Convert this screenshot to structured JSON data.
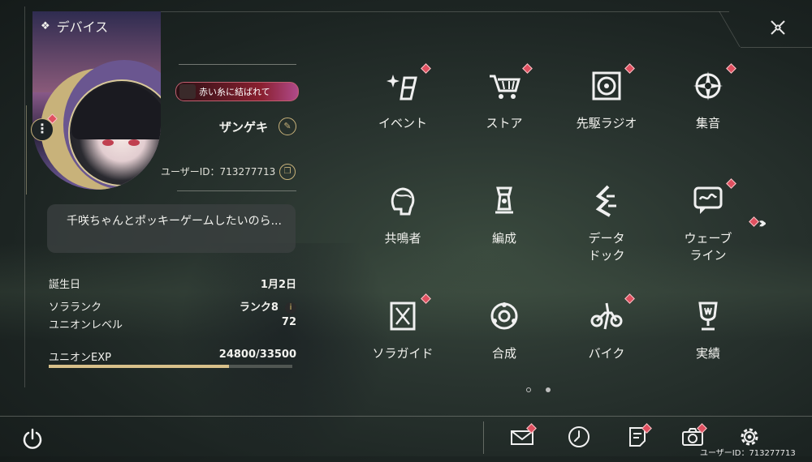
{
  "header": {
    "title": "デバイス",
    "title_icon": "diamond-cluster-icon"
  },
  "profile": {
    "badge": "赤い糸に結ばれて",
    "username": "ザンゲキ",
    "user_id_label": "ユーザーID：713277713",
    "signature": "千咲ちゃんとポッキーゲームしたいのら..."
  },
  "stats": {
    "birthday": {
      "label": "誕生日",
      "value": "1月2日"
    },
    "rank": {
      "label": "ソラランク",
      "value": "ランク8"
    },
    "level": {
      "label": "ユニオンレベル",
      "value": "72"
    },
    "exp": {
      "label": "ユニオンEXP",
      "value": "24800/33500",
      "fill": 0.74
    }
  },
  "menu": [
    {
      "label": "イベント",
      "icon": "event-sparkle-icon",
      "badge": true
    },
    {
      "label": "ストア",
      "icon": "cart-icon",
      "badge": true
    },
    {
      "label": "先駆ラジオ",
      "icon": "radio-vinyl-icon",
      "badge": true
    },
    {
      "label": "集音",
      "icon": "compass-star-icon",
      "badge": true
    },
    {
      "label": "共鳴者",
      "icon": "character-head-icon",
      "badge": false
    },
    {
      "label": "編成",
      "icon": "chess-pieces-icon",
      "badge": false
    },
    {
      "label": "データ\nドック",
      "icon": "data-dock-icon",
      "badge": false
    },
    {
      "label": "ウェーブ\nライン",
      "icon": "wave-chat-icon",
      "badge": true
    },
    {
      "label": "ソラガイド",
      "icon": "guide-book-icon",
      "badge": true
    },
    {
      "label": "合成",
      "icon": "synthesis-ring-icon",
      "badge": false
    },
    {
      "label": "バイク",
      "icon": "motorbike-icon",
      "badge": true
    },
    {
      "label": "実績",
      "icon": "trophy-icon",
      "badge": false
    }
  ],
  "bottom_bar": {
    "icons": [
      "mail-icon",
      "clock-icon",
      "notes-icon",
      "camera-icon",
      "settings-gear-icon"
    ],
    "user_id": "ユーザーID：713277713"
  },
  "colors": {
    "accent": "#c8b27a",
    "badge_red": "#e05060"
  }
}
